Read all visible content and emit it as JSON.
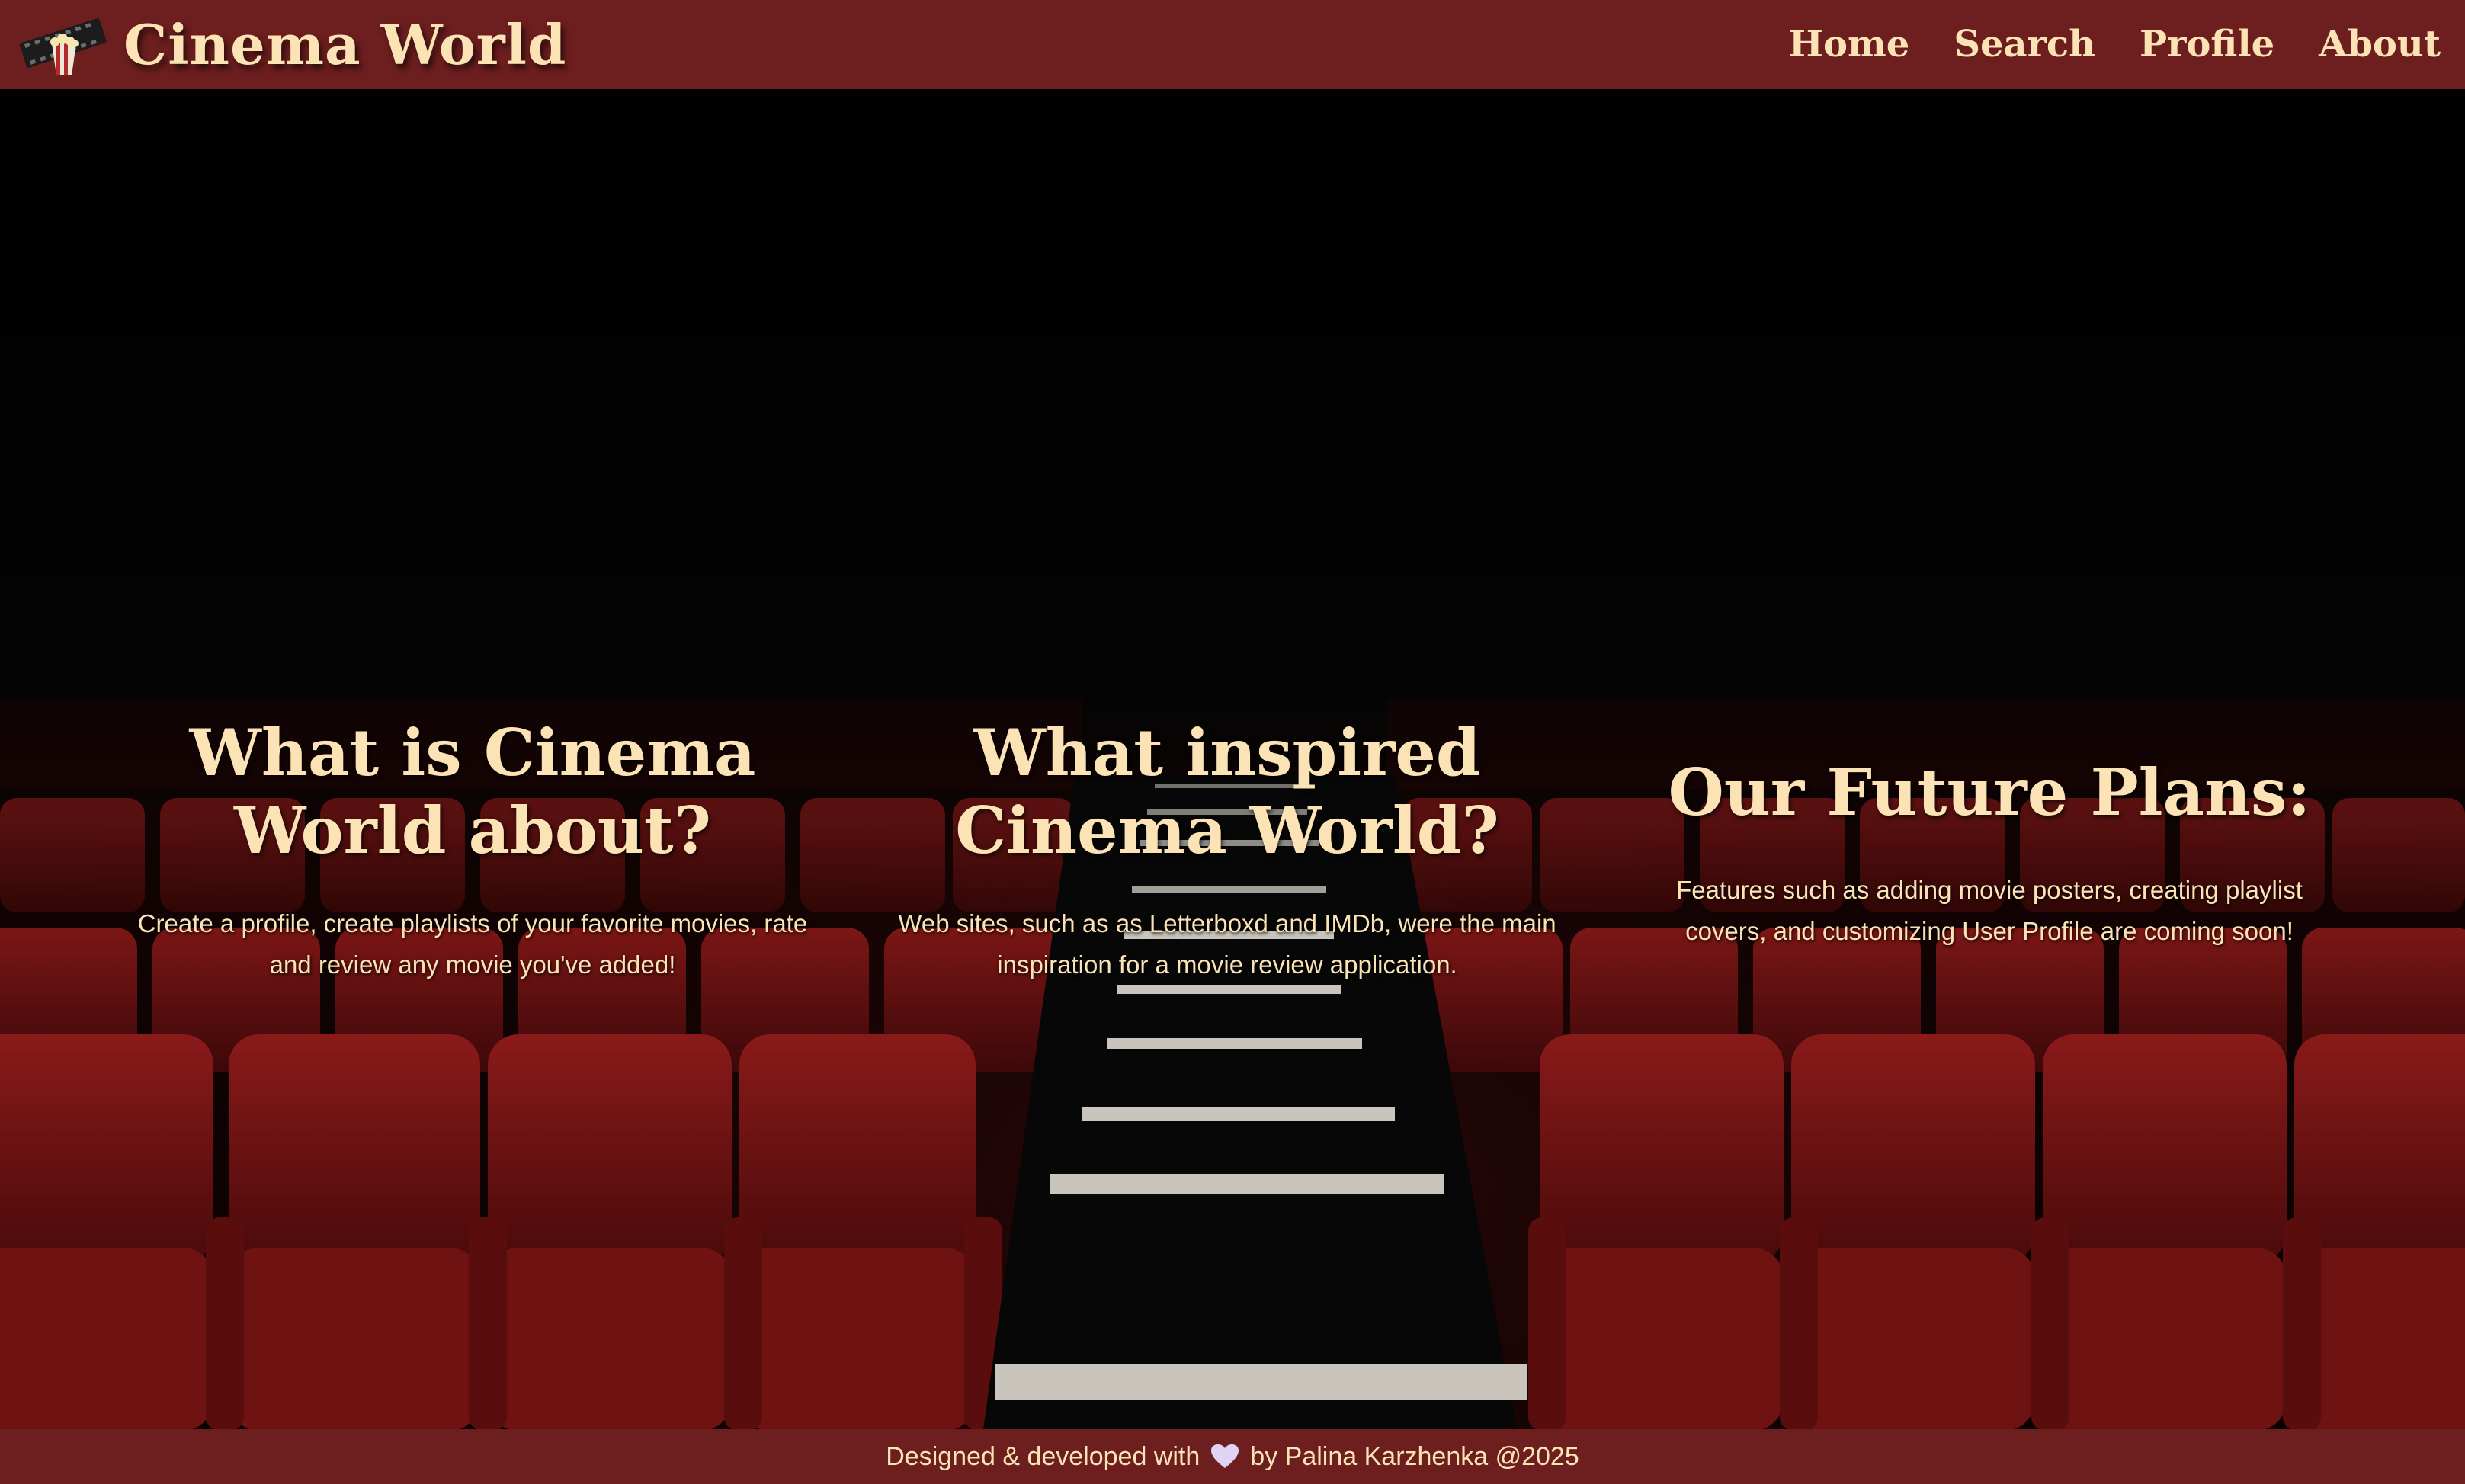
{
  "header": {
    "brand_title": "Cinema World",
    "logo_icon": "film-reel-popcorn-icon",
    "nav": [
      {
        "label": "Home"
      },
      {
        "label": "Search"
      },
      {
        "label": "Profile"
      },
      {
        "label": "About"
      }
    ]
  },
  "sections": [
    {
      "heading": "What is Cinema World about?",
      "text": "Create a profile, create playlists of your favorite movies, rate and review any movie you've added!"
    },
    {
      "heading": "What inspired Cinema World?",
      "text": "Web sites, such as as Letterboxd and IMDb, were the main inspiration for a movie review application."
    },
    {
      "heading": "Our Future Plans:",
      "text": "Features such as adding movie posters, creating playlist covers, and customizing User Profile are coming soon!"
    }
  ],
  "footer": {
    "prefix": "Designed & developed with",
    "heart_icon": "heart-icon",
    "suffix": "by Palina Karzhenka @2025"
  },
  "colors": {
    "header_bg": "#6d1e1e",
    "accent_text": "#fbe3b5",
    "seat_red": "#7a1414",
    "background": "#000000"
  },
  "background_image": "theater-seats-aisle-photo"
}
